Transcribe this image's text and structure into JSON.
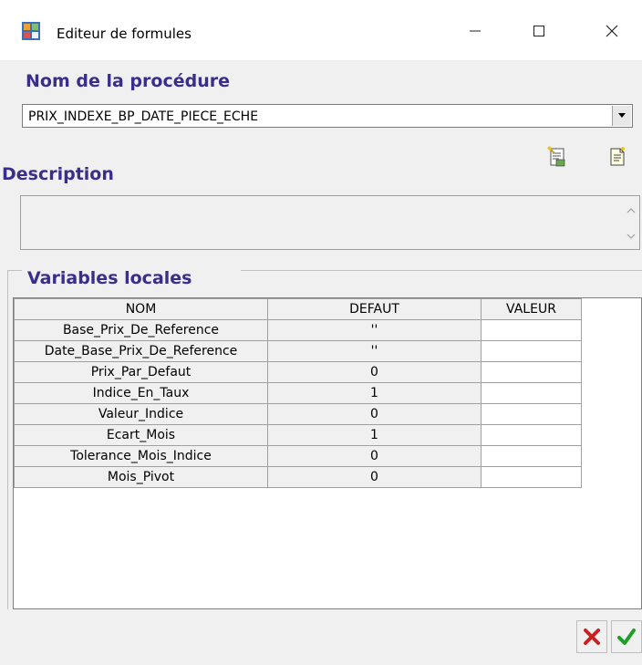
{
  "window": {
    "title": "Editeur de formules",
    "minimize_icon": "minimize-icon",
    "maximize_icon": "maximize-icon",
    "close_icon": "close-icon"
  },
  "procedure": {
    "label": "Nom de la procédure",
    "selected": "PRIX_INDEXE_BP_DATE_PIECE_ECHE"
  },
  "description": {
    "label": "Description",
    "value": ""
  },
  "toolbar": {
    "icons": [
      "formula-wizard-icon",
      "document-icon"
    ]
  },
  "variables": {
    "label": "Variables locales",
    "columns": [
      "NOM",
      "DEFAUT",
      "VALEUR"
    ],
    "rows": [
      {
        "nom": "Base_Prix_De_Reference",
        "defaut": "''",
        "valeur": ""
      },
      {
        "nom": "Date_Base_Prix_De_Reference",
        "defaut": "''",
        "valeur": ""
      },
      {
        "nom": "Prix_Par_Defaut",
        "defaut": "0",
        "valeur": ""
      },
      {
        "nom": "Indice_En_Taux",
        "defaut": "1",
        "valeur": ""
      },
      {
        "nom": "Valeur_Indice",
        "defaut": "0",
        "valeur": ""
      },
      {
        "nom": "Ecart_Mois",
        "defaut": "1",
        "valeur": ""
      },
      {
        "nom": "Tolerance_Mois_Indice",
        "defaut": "0",
        "valeur": ""
      },
      {
        "nom": "Mois_Pivot",
        "defaut": "0",
        "valeur": ""
      }
    ]
  },
  "buttons": {
    "cancel_icon": "red-x-icon",
    "ok_icon": "green-check-icon"
  },
  "colors": {
    "section_title": "#3a2e8c",
    "cancel": "#cc1f1f",
    "ok": "#1e9e2a"
  }
}
